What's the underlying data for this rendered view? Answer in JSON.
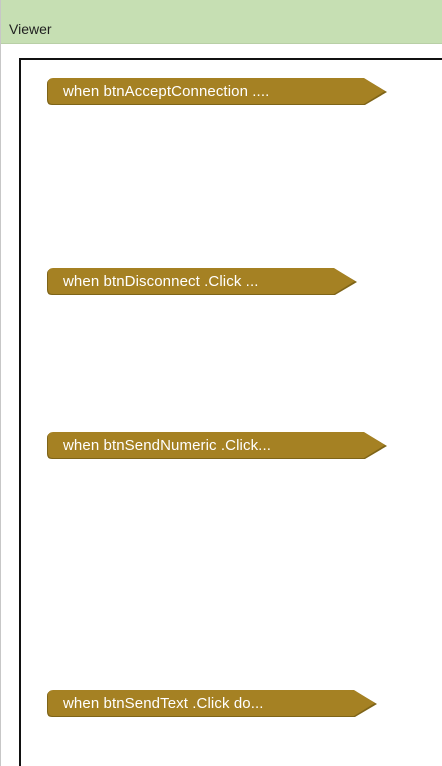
{
  "viewer": {
    "title": "Viewer"
  },
  "blocks": [
    {
      "label": "when  btnAcceptConnection ...."
    },
    {
      "label": "when  btnDisconnect .Click ..."
    },
    {
      "label": "when  btnSendNumeric .Click..."
    },
    {
      "label": "when  btnSendText .Click do..."
    }
  ],
  "colors": {
    "header_background": "#c6dfb3",
    "block_color": "#a58123"
  }
}
